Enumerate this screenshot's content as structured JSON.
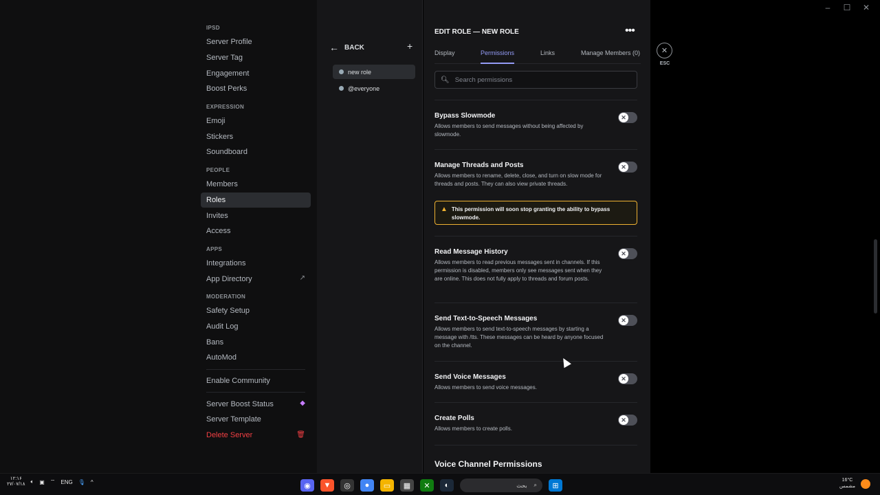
{
  "window": {
    "minimize": "–",
    "maximize": "☐",
    "close": "✕"
  },
  "sidebar": {
    "sections": [
      {
        "header": "IPSD",
        "items": [
          {
            "label": "Server Profile"
          },
          {
            "label": "Server Tag"
          },
          {
            "label": "Engagement"
          },
          {
            "label": "Boost Perks"
          }
        ]
      },
      {
        "header": "EXPRESSION",
        "items": [
          {
            "label": "Emoji"
          },
          {
            "label": "Stickers"
          },
          {
            "label": "Soundboard"
          }
        ]
      },
      {
        "header": "PEOPLE",
        "items": [
          {
            "label": "Members"
          },
          {
            "label": "Roles",
            "active": true
          },
          {
            "label": "Invites"
          },
          {
            "label": "Access"
          }
        ]
      },
      {
        "header": "APPS",
        "items": [
          {
            "label": "Integrations"
          },
          {
            "label": "App Directory",
            "icon": "external-link-icon"
          }
        ]
      },
      {
        "header": "MODERATION",
        "items": [
          {
            "label": "Safety Setup"
          },
          {
            "label": "Audit Log"
          },
          {
            "label": "Bans"
          },
          {
            "label": "AutoMod"
          }
        ]
      }
    ],
    "enable_community": "Enable Community",
    "boost_status": "Server Boost Status",
    "server_template": "Server Template",
    "delete_server": "Delete Server"
  },
  "roles": {
    "back_label": "BACK",
    "list": [
      {
        "name": "new role",
        "selected": true
      },
      {
        "name": "@everyone"
      }
    ]
  },
  "editor": {
    "title": "EDIT ROLE — NEW ROLE",
    "tabs": [
      {
        "label": "Display"
      },
      {
        "label": "Permissions",
        "active": true
      },
      {
        "label": "Links"
      },
      {
        "label": "Manage Members (0)"
      }
    ],
    "search_placeholder": "Search permissions",
    "permissions": [
      {
        "name": "Bypass Slowmode",
        "desc": "Allows members to send messages without being affected by slowmode.",
        "enabled": false
      },
      {
        "name": "Manage Threads and Posts",
        "desc": "Allows members to rename, delete, close, and turn on slow mode for threads and posts. They can also view private threads.",
        "enabled": false
      },
      {
        "name": "Read Message History",
        "desc": "Allows members to read previous messages sent in channels. If this permission is disabled, members only see messages sent when they are online. This does not fully apply to threads and forum posts.",
        "enabled": false
      },
      {
        "name": "Send Text-to-Speech Messages",
        "desc": "Allows members to send text-to-speech messages by starting a message with /tts. These messages can be heard by anyone focused on the channel.",
        "enabled": false
      },
      {
        "name": "Send Voice Messages",
        "desc": "Allows members to send voice messages.",
        "enabled": false
      },
      {
        "name": "Create Polls",
        "desc": "Allows members to create polls.",
        "enabled": false
      }
    ],
    "warning": "This permission will soon stop granting the ability to bypass slowmode.",
    "voice_header": "Voice Channel Permissions"
  },
  "esc_label": "ESC",
  "taskbar": {
    "time": "۱۲:۱۶",
    "date": "۲۷/۰۷/۱۸",
    "lang": "ENG",
    "search_text": "بحث",
    "weather_temp": "16°C",
    "weather_desc": "مشمس"
  }
}
